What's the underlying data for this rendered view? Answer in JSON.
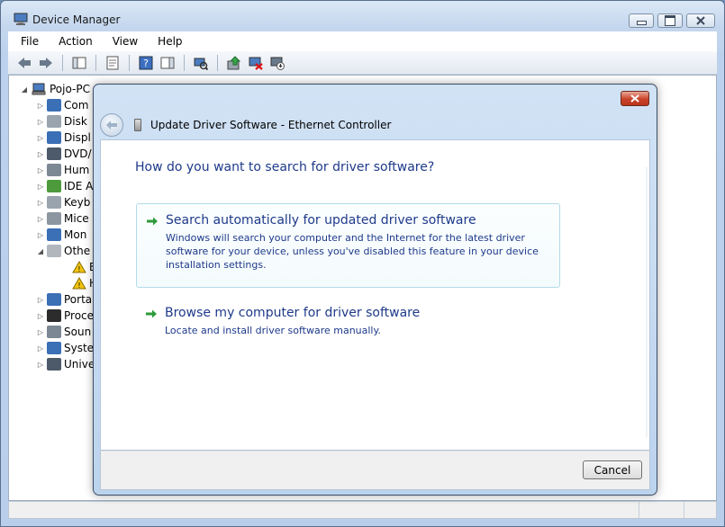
{
  "window": {
    "title": "Device Manager",
    "app_icon": "device-manager-icon"
  },
  "menu": [
    "File",
    "Action",
    "View",
    "Help"
  ],
  "toolbar_icons": [
    "back-icon",
    "forward-icon",
    "show-hide-tree-icon",
    "properties-icon",
    "help-icon",
    "action-pane-icon",
    "scan-hardware-icon",
    "update-driver-icon",
    "uninstall-icon",
    "disable-icon"
  ],
  "tree": {
    "root": "Pojo-PC",
    "nodes": [
      {
        "label": "Com",
        "icon": "computer-icon",
        "color": "#3b6fb6",
        "expanded": false
      },
      {
        "label": "Disk",
        "icon": "disk-icon",
        "color": "#9aa4ae",
        "expanded": false
      },
      {
        "label": "Displ",
        "icon": "display-icon",
        "color": "#3b6fb6",
        "expanded": false
      },
      {
        "label": "DVD/",
        "icon": "dvd-icon",
        "color": "#4c5a6a",
        "expanded": false
      },
      {
        "label": "Hum",
        "icon": "hid-icon",
        "color": "#7c8894",
        "expanded": false
      },
      {
        "label": "IDE A",
        "icon": "ide-icon",
        "color": "#4c9a3c",
        "expanded": false
      },
      {
        "label": "Keyb",
        "icon": "keyboard-icon",
        "color": "#9aa4ae",
        "expanded": false
      },
      {
        "label": "Mice",
        "icon": "mouse-icon",
        "color": "#8c96a0",
        "expanded": false
      },
      {
        "label": "Mon",
        "icon": "monitor-icon",
        "color": "#3b6fb6",
        "expanded": false
      },
      {
        "label": "Othe",
        "icon": "other-devices-icon",
        "color": "#b0b6bc",
        "expanded": true
      },
      {
        "label": "E",
        "icon": "warning-device-icon",
        "color": "#e2c04a",
        "child": true
      },
      {
        "label": "H",
        "icon": "warning-device-icon",
        "color": "#e2c04a",
        "child": true
      },
      {
        "label": "Porta",
        "icon": "portable-icon",
        "color": "#3b6fb6",
        "expanded": false
      },
      {
        "label": "Proce",
        "icon": "processor-icon",
        "color": "#2c2c2c",
        "expanded": false
      },
      {
        "label": "Soun",
        "icon": "sound-icon",
        "color": "#7c8894",
        "expanded": false
      },
      {
        "label": "Syste",
        "icon": "system-icon",
        "color": "#3b6fb6",
        "expanded": false
      },
      {
        "label": "Unive",
        "icon": "usb-icon",
        "color": "#4c5a6a",
        "expanded": false
      }
    ]
  },
  "dialog": {
    "title": "Update Driver Software - Ethernet Controller",
    "heading": "How do you want to search for driver software?",
    "options": [
      {
        "title": "Search automatically for updated driver software",
        "description": "Windows will search your computer and the Internet for the latest driver software for your device, unless you've disabled this feature in your device installation settings."
      },
      {
        "title": "Browse my computer for driver software",
        "description": "Locate and install driver software manually."
      }
    ],
    "cancel_label": "Cancel",
    "accent": "#1e3a8a",
    "arrow_color": "#2e9a3a"
  }
}
